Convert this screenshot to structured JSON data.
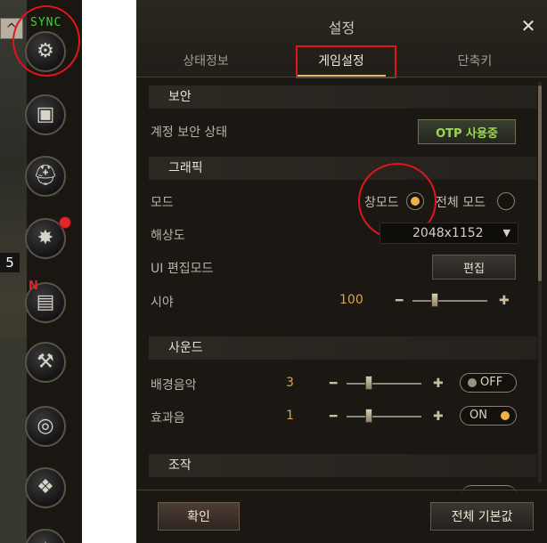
{
  "sidebar": {
    "sync_text": "SYNC",
    "level_number": "5",
    "new_badge": "N",
    "icons": [
      "gear-icon",
      "chest-icon",
      "helmet-icon",
      "compass-icon",
      "scroll-icon",
      "anvil-icon",
      "swirl-icon",
      "wolf-icon",
      "emblem-icon"
    ]
  },
  "settings": {
    "title": "설정",
    "close_glyph": "✕",
    "tabs": [
      {
        "label": "상태정보",
        "active": false
      },
      {
        "label": "게임설정",
        "active": true
      },
      {
        "label": "단축키",
        "active": false
      }
    ],
    "security": {
      "section": "보안",
      "account_label": "계정 보안 상태",
      "otp_button": "OTP 사용중"
    },
    "graphics": {
      "section": "그래픽",
      "mode_label": "모드",
      "window_mode": "창모드",
      "full_mode": "전체 모드",
      "selected_mode": "창모드",
      "resolution_label": "해상도",
      "resolution_value": "2048x1152",
      "ui_edit_label": "UI 편집모드",
      "edit_button": "편집",
      "view_label": "시야",
      "view_value": "100",
      "view_level": 0.3
    },
    "sound": {
      "section": "사운드",
      "bgm_label": "배경음악",
      "bgm_value": "3",
      "bgm_level": 0.3,
      "bgm_toggle": "OFF",
      "sfx_label": "효과음",
      "sfx_value": "1",
      "sfx_level": 0.3,
      "sfx_toggle": "ON"
    },
    "control": {
      "section": "조작"
    },
    "footer": {
      "confirm_button": "확인",
      "default_button": "전체 기본값"
    }
  },
  "colors": {
    "accent_gold": "#d9a544",
    "otp_green": "#9ed64e",
    "highlight_red": "#e3141c",
    "sync_green": "#3dd23b",
    "radio_on": "#f0b343"
  }
}
